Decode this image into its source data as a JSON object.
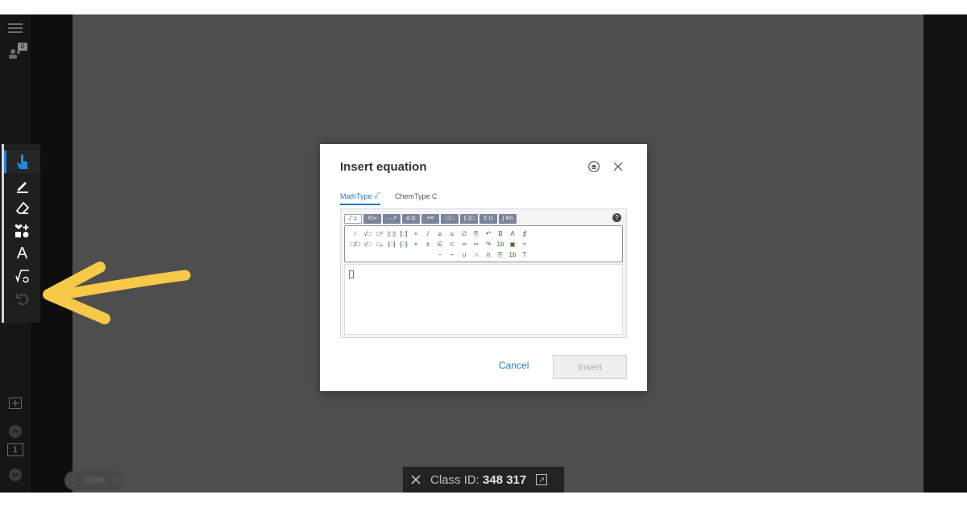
{
  "dialog": {
    "title": "Insert equation",
    "tabs": [
      {
        "label": "MathType √‾",
        "active": true
      },
      {
        "label": "ChemType C",
        "active": false
      }
    ],
    "ribbon_tabs": [
      "√̅ ∓",
      "∈∞",
      "→↗",
      "α Ω",
      "≡≡",
      "□□",
      "(□)□",
      "Σ U",
      "∫ lim"
    ],
    "palette_row1": [
      "∕",
      "√□",
      "□²",
      "(□)",
      "[□]",
      "+",
      "/",
      "≥",
      "≤",
      "∅",
      "⎘",
      "↶",
      "B",
      "A",
      "⨋"
    ],
    "palette_row2": [
      "□/□",
      "√□",
      "□₀",
      "|□|",
      "{□}",
      "×",
      "±",
      "∈",
      "⊂",
      "∞",
      "✂",
      "↷",
      "1b",
      "▣",
      "≈"
    ],
    "palette_row3": [
      "−",
      "÷",
      "∪",
      "∩",
      "π",
      "⎘",
      "1b",
      "T"
    ],
    "cancel_label": "Cancel",
    "insert_label": "Insert",
    "help_label": "?"
  },
  "class_bar": {
    "prefix": "Class ID:",
    "id": "348 317"
  },
  "zoom": {
    "minus": "−",
    "value": "100%",
    "plus": "+"
  },
  "rail": {
    "participants_count": "0",
    "page_number": "1"
  },
  "toolbar": {
    "text_tool_label": "A"
  },
  "colors": {
    "accent": "#1e88e5",
    "arrow": "#f7c948"
  }
}
